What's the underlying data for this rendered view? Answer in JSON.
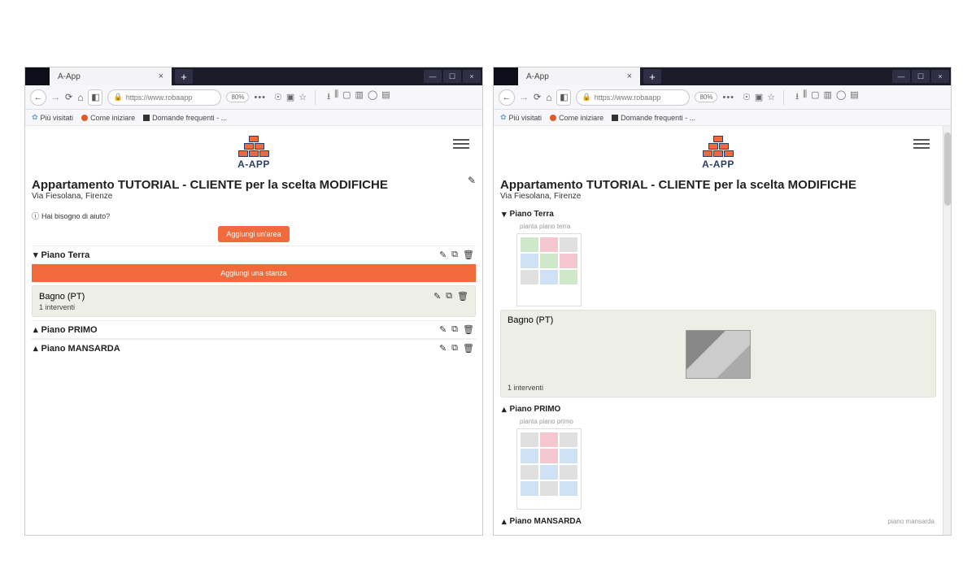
{
  "browser": {
    "tab_title": "A-App",
    "url_display": "https://www.robaapp",
    "zoom": "80%",
    "bookmarks": [
      {
        "label": "Più visitati",
        "icon": "star",
        "color": "#6aa2d8"
      },
      {
        "label": "Come iniziare",
        "icon": "dot",
        "color": "#e05a2b"
      },
      {
        "label": "Domande frequenti - ...",
        "icon": "square",
        "color": "#333"
      }
    ]
  },
  "app": {
    "logo_text": "A-APP",
    "title": "Appartamento TUTORIAL - CLIENTE per la scelta MODIFICHE",
    "subtitle": "Via Fiesolana, Firenze",
    "help_text": "Hai bisogno di aiuto?",
    "add_area_label": "Aggiungi un'area",
    "add_room_label": "Aggiungi una stanza"
  },
  "areas_left": [
    {
      "name": "Piano Terra",
      "expanded": true
    },
    {
      "name": "Piano PRIMO",
      "expanded": false
    },
    {
      "name": "Piano MANSARDA",
      "expanded": false
    }
  ],
  "areas_right": [
    {
      "name": "Piano Terra",
      "expanded": true
    },
    {
      "name": "Piano PRIMO",
      "expanded": false
    },
    {
      "name": "Piano MANSARDA",
      "expanded": false
    }
  ],
  "room": {
    "name": "Bagno (PT)",
    "sub": "1 interventi"
  },
  "plan_labels": {
    "terra": "pianta piano terra",
    "primo": "pianta piano primo",
    "mansarda": "piano mansarda"
  }
}
